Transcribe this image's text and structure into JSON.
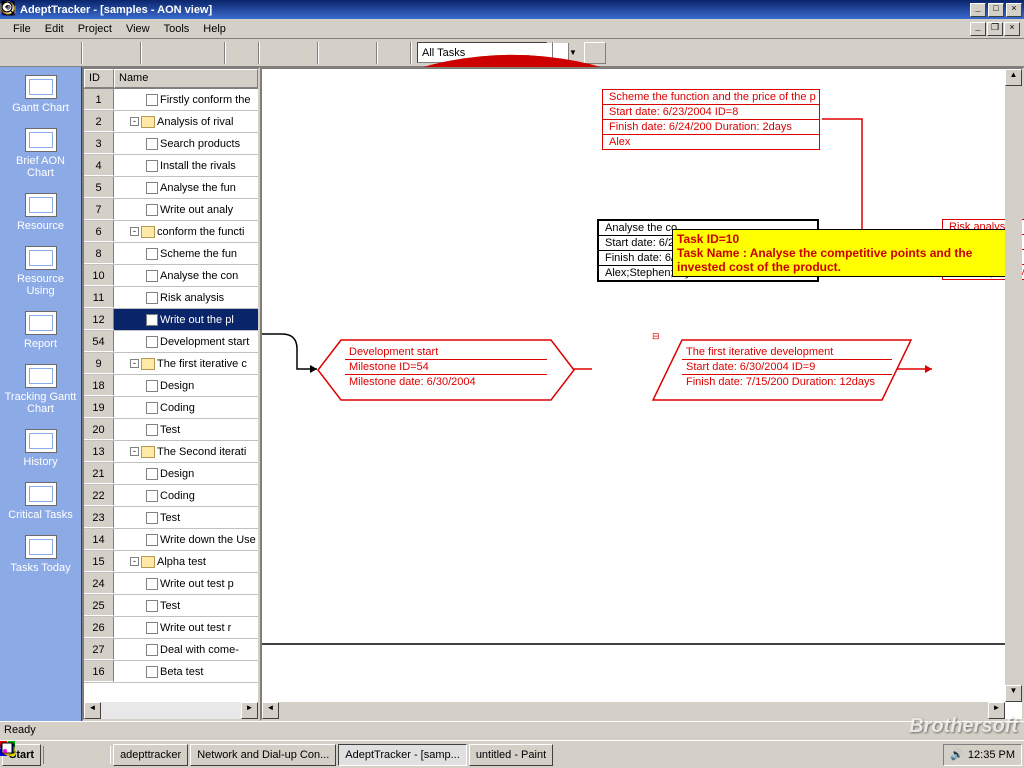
{
  "titlebar": {
    "text": "AdeptTracker - [samples - AON view]"
  },
  "menu": {
    "items": [
      "File",
      "Edit",
      "Project",
      "View",
      "Tools",
      "Help"
    ]
  },
  "toolbar": {
    "filter_label": "All Tasks"
  },
  "sidebar": {
    "items": [
      "Gantt Chart",
      "Brief AON Chart",
      "Resource",
      "Resource Using",
      "Report",
      "Tracking Gantt Chart",
      "History",
      "Critical Tasks",
      "Tasks Today"
    ]
  },
  "columns": {
    "id": "ID",
    "name": "Name"
  },
  "tasks": [
    {
      "id": "1",
      "name": "Firstly conform the",
      "lvl": 2,
      "type": "doc"
    },
    {
      "id": "2",
      "name": "Analysis of rival",
      "lvl": 1,
      "type": "fold",
      "exp": "-"
    },
    {
      "id": "3",
      "name": "Search products",
      "lvl": 2,
      "type": "doc"
    },
    {
      "id": "4",
      "name": "Install the rivals",
      "lvl": 2,
      "type": "doc"
    },
    {
      "id": "5",
      "name": "Analyse the fun",
      "lvl": 2,
      "type": "doc"
    },
    {
      "id": "7",
      "name": "Write out analy",
      "lvl": 2,
      "type": "doc"
    },
    {
      "id": "6",
      "name": "conform the functi",
      "lvl": 1,
      "type": "fold",
      "exp": "-"
    },
    {
      "id": "8",
      "name": "Scheme the fun",
      "lvl": 2,
      "type": "doc"
    },
    {
      "id": "10",
      "name": "Analyse the con",
      "lvl": 2,
      "type": "doc"
    },
    {
      "id": "11",
      "name": "Risk analysis",
      "lvl": 2,
      "type": "doc"
    },
    {
      "id": "12",
      "name": "Write out the pl",
      "lvl": 2,
      "type": "doc",
      "sel": true
    },
    {
      "id": "54",
      "name": "Development start",
      "lvl": 2,
      "type": "doc"
    },
    {
      "id": "9",
      "name": "The first iterative c",
      "lvl": 1,
      "type": "fold",
      "exp": "-"
    },
    {
      "id": "18",
      "name": "Design",
      "lvl": 2,
      "type": "doc"
    },
    {
      "id": "19",
      "name": "Coding",
      "lvl": 2,
      "type": "doc"
    },
    {
      "id": "20",
      "name": "Test",
      "lvl": 2,
      "type": "doc"
    },
    {
      "id": "13",
      "name": "The Second iterati",
      "lvl": 1,
      "type": "fold",
      "exp": "-"
    },
    {
      "id": "21",
      "name": "Design",
      "lvl": 2,
      "type": "doc"
    },
    {
      "id": "22",
      "name": "Coding",
      "lvl": 2,
      "type": "doc"
    },
    {
      "id": "23",
      "name": "Test",
      "lvl": 2,
      "type": "doc"
    },
    {
      "id": "14",
      "name": "Write down the Use",
      "lvl": 2,
      "type": "doc"
    },
    {
      "id": "15",
      "name": "Alpha test",
      "lvl": 1,
      "type": "fold",
      "exp": "-"
    },
    {
      "id": "24",
      "name": "Write out test p",
      "lvl": 2,
      "type": "doc"
    },
    {
      "id": "25",
      "name": "Test",
      "lvl": 2,
      "type": "doc"
    },
    {
      "id": "26",
      "name": "Write out test r",
      "lvl": 2,
      "type": "doc"
    },
    {
      "id": "27",
      "name": "Deal with come-",
      "lvl": 2,
      "type": "doc"
    },
    {
      "id": "16",
      "name": "Beta test",
      "lvl": 2,
      "type": "doc"
    }
  ],
  "nodes": {
    "n8": {
      "title": "Scheme the function and the price of the p",
      "start": "Start date: 6/23/2004  ID=8",
      "finish": "Finish date: 6/24/200  Duration: 2days",
      "res": "Alex"
    },
    "n10": {
      "title": "Analyse the co",
      "start": "Start date: 6/2",
      "finish": "Finish date: 6/",
      "res": "Alex;Stephen;Joyce"
    },
    "n11": {
      "title": "Risk analysis",
      "start": "",
      "finish": "",
      "res": "Alex;Stephen;Michael"
    },
    "n54": {
      "title": "Development start",
      "mile": "Milestone              ID=54",
      "date": "Milestone date: 6/30/2004"
    },
    "n9": {
      "title": "The first iterative development",
      "start": "Start date: 6/30/2004  ID=9",
      "finish": "Finish date: 7/15/200  Duration: 12days"
    }
  },
  "tooltip": {
    "line1": "Task ID=10",
    "line2": "Task Name : Analyse the competitive points and the invested cost of the product."
  },
  "status": {
    "text": "Ready"
  },
  "taskbar": {
    "start": "Start",
    "items": [
      {
        "label": "adepttracker",
        "active": false
      },
      {
        "label": "Network and Dial-up Con...",
        "active": false
      },
      {
        "label": "AdeptTracker - [samp...",
        "active": true
      },
      {
        "label": "untitled - Paint",
        "active": false
      }
    ],
    "time": "12:35 PM"
  },
  "watermark": "Brothersoft"
}
